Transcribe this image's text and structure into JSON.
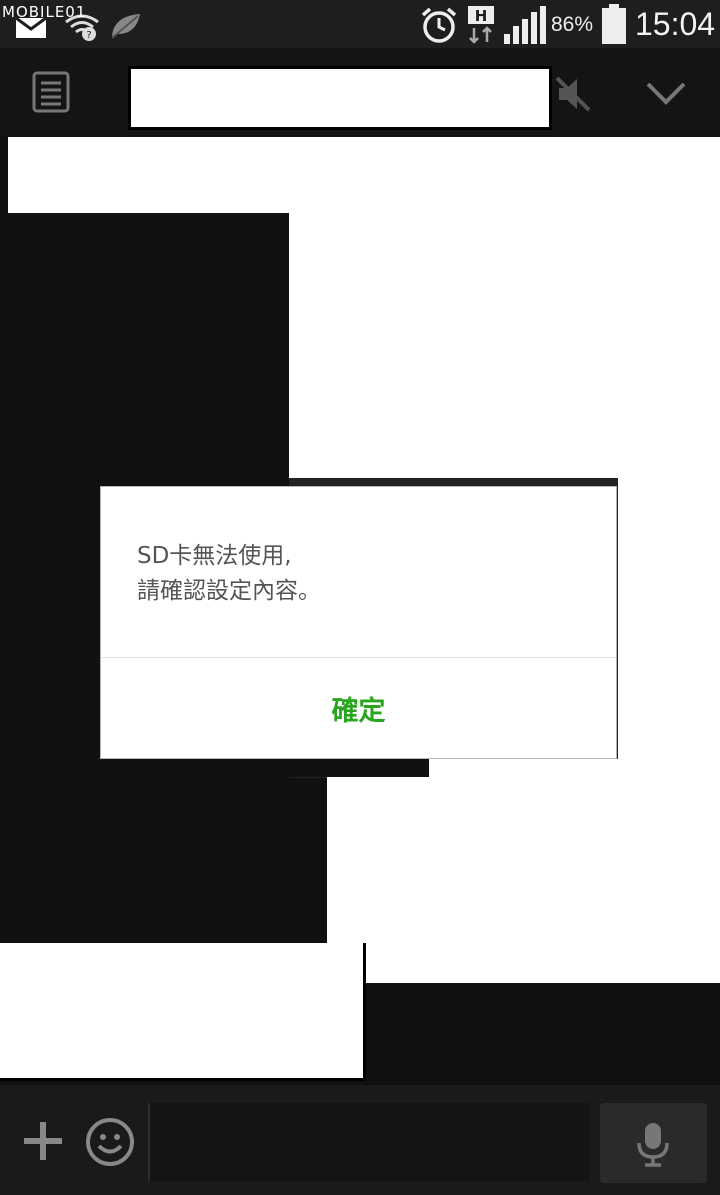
{
  "status_bar": {
    "watermark": "MOBILE01",
    "battery_percent": "86%",
    "clock": "15:04",
    "icons": [
      "mail-icon",
      "wifi-question-icon",
      "leaf-icon",
      "alarm-icon",
      "h-network-icon",
      "signal-icon",
      "battery-icon"
    ]
  },
  "header": {
    "menu_icon": "list-icon",
    "mute_icon": "speaker-mute-icon",
    "expand_icon": "chevron-down-icon"
  },
  "dialog": {
    "message_line1": "SD卡無法使用,",
    "message_line2": "請確認設定內容。",
    "confirm_label": "確定",
    "confirm_color": "#2aa51e"
  },
  "input_bar": {
    "message_value": "",
    "icons": [
      "plus-icon",
      "smiley-icon",
      "microphone-icon"
    ]
  }
}
